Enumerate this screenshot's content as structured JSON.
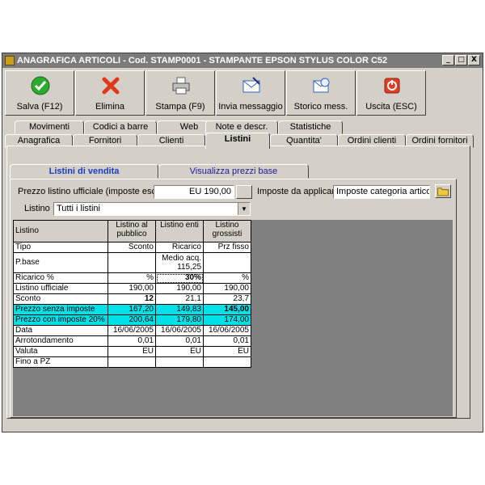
{
  "window": {
    "title": "ANAGRAFICA ARTICOLI - Cod. STAMP0001 - STAMPANTE EPSON STYLUS COLOR C52"
  },
  "window_controls": {
    "minimize": "_",
    "maximize": "□",
    "close": "X"
  },
  "toolbar": {
    "buttons": [
      {
        "label": "Salva (F12)",
        "icon": "check-icon",
        "color": "#2eaa2e"
      },
      {
        "label": "Elimina",
        "icon": "delete-x-icon",
        "color": "#e03a1a"
      },
      {
        "label": "Stampa (F9)",
        "icon": "printer-icon",
        "color": "#606060"
      },
      {
        "label": "Invia messaggio",
        "icon": "send-message-icon",
        "color": "#3060c0"
      },
      {
        "label": "Storico mess.",
        "icon": "message-history-icon",
        "color": "#3060c0"
      },
      {
        "label": "Uscita (ESC)",
        "icon": "exit-icon",
        "color": "#e04020"
      }
    ]
  },
  "tabs_row1": [
    "Movimenti",
    "Codici a barre",
    "Web",
    "Note e descr.",
    "Statistiche"
  ],
  "tabs_row2": [
    "Anagrafica",
    "Fornitori",
    "Clienti",
    "Listini",
    "Quantita'",
    "Ordini clienti",
    "Ordini fornitori"
  ],
  "active_tab": "Listini",
  "subtabs": [
    "Listini di vendita",
    "Visualizza prezzi base"
  ],
  "form": {
    "prezzo_label": "Prezzo listino ufficiale (imposte escluse) :",
    "prezzo_value": "EU 190,00",
    "imposte_label": "Imposte da applicare :",
    "imposte_value": "Imposte categoria articolo",
    "listino_label": "Listino :",
    "listino_value": "Tutti i listini"
  },
  "grid": {
    "headers": [
      "Listino",
      "Listino al pubblico",
      "Listino enti",
      "Listino grossisti"
    ],
    "rows": [
      {
        "label": "Tipo",
        "values": [
          "Sconto",
          "Ricarico",
          "Prz fisso"
        ]
      },
      {
        "label": "P.base",
        "values": [
          "",
          "Medio acq. 115,25",
          ""
        ]
      },
      {
        "label": "Ricarico %",
        "values": [
          "%",
          "30%",
          "%"
        ]
      },
      {
        "label": "Listino ufficiale",
        "values": [
          "190,00",
          "190,00",
          "190,00"
        ]
      },
      {
        "label": "Sconto",
        "values": [
          "12",
          "21,1",
          "23,7"
        ]
      },
      {
        "label": "Prezzo senza imposte",
        "values": [
          "167,20",
          "149,83",
          "145,00"
        ]
      },
      {
        "label": "Prezzo con imposte 20%",
        "values": [
          "200,64",
          "179,80",
          "174,00"
        ]
      },
      {
        "label": "Data",
        "values": [
          "16/06/2005",
          "16/06/2005",
          "16/06/2005"
        ]
      },
      {
        "label": "Arrotondamento",
        "values": [
          "0,01",
          "0,01",
          "0,01"
        ]
      },
      {
        "label": "Valuta",
        "values": [
          "EU",
          "EU",
          "EU"
        ]
      },
      {
        "label": "Fino a PZ",
        "values": [
          "",
          "",
          ""
        ]
      }
    ],
    "highlight_color": "#00e0e8"
  }
}
